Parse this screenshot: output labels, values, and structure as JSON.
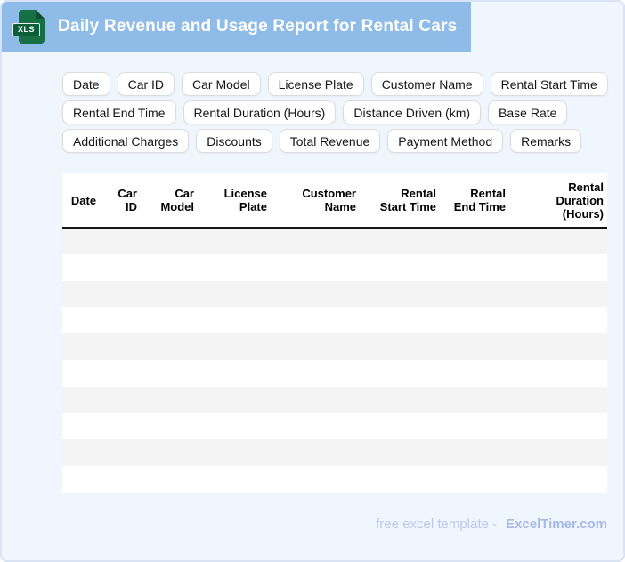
{
  "header": {
    "title": "Daily Revenue and Usage Report for Rental Cars",
    "file_type": "XLS"
  },
  "chips": {
    "rows": [
      [
        "Date",
        "Car ID",
        "Car Model",
        "License Plate",
        "Customer Name",
        "Rental Start Time"
      ],
      [
        "Rental End Time",
        "Rental Duration (Hours)",
        "Distance Driven (km)",
        "Base Rate"
      ],
      [
        "Additional Charges",
        "Discounts",
        "Total Revenue",
        "Payment Method",
        "Remarks"
      ]
    ]
  },
  "table": {
    "columns": [
      "Date",
      "Car ID",
      "Car Model",
      "License Plate",
      "Customer Name",
      "Rental Start Time",
      "Rental End Time",
      "Rental Duration (Hours)"
    ],
    "empty_row_count": 10
  },
  "footer": {
    "text": "free excel template -",
    "brand": "ExcelTimer.com"
  },
  "colors": {
    "banner_blue": "#8FBBE8",
    "page_background": "#F0F6FD",
    "page_border": "#D9E3F3",
    "icon_green": "#157143",
    "icon_band_green": "#0B5E37",
    "row_stripe": "#F4F4F4",
    "header_rule": "#141414",
    "footer_text": "#BCC8EE",
    "footer_brand": "#A6B7EA"
  }
}
